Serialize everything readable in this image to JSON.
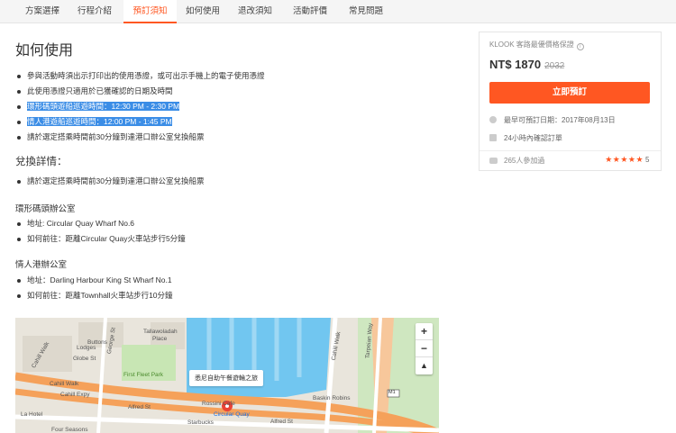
{
  "tabs": [
    "方案選擇",
    "行程介紹",
    "預訂須知",
    "如何使用",
    "退改須知",
    "活動評價",
    "常見問題"
  ],
  "active_tab": "預訂須知",
  "main": {
    "title": "如何使用",
    "usage_items": [
      "參與活動時須出示打印出的使用憑證，或可出示手機上的電子使用憑證",
      "此使用憑證只適用於已獲確認的日期及時間",
      "環形碼頭遊船巡遊時間：12:30 PM - 2:30 PM",
      "情人港遊船巡遊時間：12:00 PM - 1:45 PM",
      "請於選定搭乘時間前30分鐘到達港口辦公室兌換船票"
    ],
    "exchange_title": "兌換詳情：",
    "exchange_items": [
      "請於選定搭乘時間前30分鐘到達港口辦公室兌換船票"
    ],
    "office1_title": "環形碼頭辦公室",
    "office1_items": [
      "地址: Circular Quay Wharf No.6",
      "如何前往：距離Circular Quay火車站步行5分鐘"
    ],
    "office2_title": "情人港辦公室",
    "office2_items": [
      "地址：Darling Harbour King St Wharf No.1",
      "如何前往：距離Townhall火車站步行10分鐘"
    ]
  },
  "map": {
    "tooltip": "悉尼自助午餐遊輪之旅",
    "labels": {
      "george_st": "George St",
      "tallawoladah": "Tallawoladah",
      "place": "Place",
      "buttons": "Buttons",
      "lodges": "Lodges",
      "globe_st": "Globe St",
      "first_fleet": "First Fleet Park",
      "cahill_walk_left": "Cahill Walk",
      "cahill_expy": "Cahill Expy",
      "alfred_st_left": "Alfred St",
      "la_hotel": "La Hotel",
      "starbucks": "Starbucks",
      "four_seasons": "Four Seasons",
      "rossini": "Rossini Cafe",
      "circular_quay": "Circular Quay",
      "alfred_st_right": "Alfred St",
      "baskin": "Baskin Robins",
      "cahill_walk_right": "Cahill Walk",
      "tarpeian": "Tarpeian Way",
      "m1": "M1"
    },
    "zoom_in": "+",
    "zoom_out": "−",
    "compass": "▲"
  },
  "booking": {
    "guarantee": "KLOOK 客路最優價格保證",
    "price": "NT$ 1870",
    "old_price": "2032",
    "button": "立即預訂",
    "earliest": "最早可預訂日期：2017年08月13日",
    "confirm": "24小時內確認訂單",
    "participants": "265人參加過",
    "stars": "★★★★★",
    "rating": "5"
  },
  "colors": {
    "accent": "#ff5722",
    "highlight": "#3b8de6",
    "water": "#71c6f0",
    "park": "#c8e6b4",
    "road": "#f5a15a"
  }
}
